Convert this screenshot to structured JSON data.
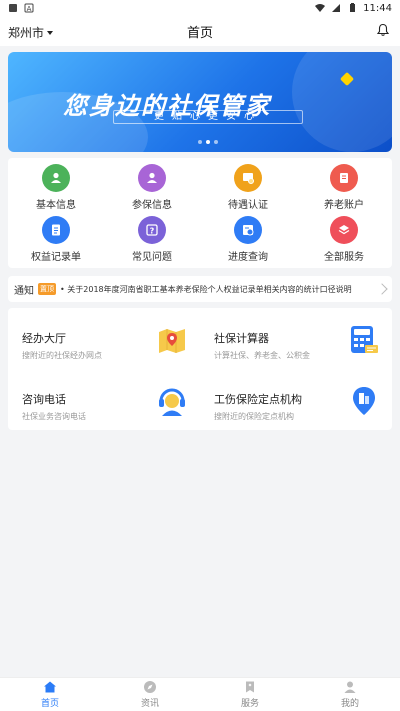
{
  "statusbar": {
    "time": "11:44"
  },
  "header": {
    "city": "郑州市",
    "title": "首页"
  },
  "banner": {
    "headline": "您身边的社保管家",
    "subline": "更贴心更安心"
  },
  "quick_menu": [
    {
      "label": "基本信息",
      "icon": "user-card-icon",
      "color": "#4cb25a"
    },
    {
      "label": "参保信息",
      "icon": "person-icon",
      "color": "#a865d6"
    },
    {
      "label": "待遇认证",
      "icon": "certificate-icon",
      "color": "#f0a21b"
    },
    {
      "label": "养老账户",
      "icon": "account-book-icon",
      "color": "#ef5b4f"
    },
    {
      "label": "权益记录单",
      "icon": "document-icon",
      "color": "#2f7cf5"
    },
    {
      "label": "常见问题",
      "icon": "question-icon",
      "color": "#7b62d8"
    },
    {
      "label": "进度查询",
      "icon": "progress-icon",
      "color": "#2f7cf5"
    },
    {
      "label": "全部服务",
      "icon": "layers-icon",
      "color": "#ef4f5a"
    }
  ],
  "notice": {
    "label": "通知",
    "tag": "置顶",
    "text": "• 关于2018年度河南省职工基本养老保险个人权益记录单相关内容的统计口径说明"
  },
  "services": [
    {
      "title": "经办大厅",
      "desc": "搜附近的社保经办网点",
      "icon": "map-pin-icon"
    },
    {
      "title": "社保计算器",
      "desc": "计算社保、养老金、公积金",
      "icon": "calculator-icon"
    },
    {
      "title": "咨询电话",
      "desc": "社保业务咨询电话",
      "icon": "headset-icon"
    },
    {
      "title": "工伤保险定点机构",
      "desc": "搜附近的保险定点机构",
      "icon": "building-pin-icon"
    }
  ],
  "tabs": [
    {
      "label": "首页",
      "icon": "home-icon",
      "active": true
    },
    {
      "label": "资讯",
      "icon": "compass-icon",
      "active": false
    },
    {
      "label": "服务",
      "icon": "bookmark-icon",
      "active": false
    },
    {
      "label": "我的",
      "icon": "profile-icon",
      "active": false
    }
  ]
}
